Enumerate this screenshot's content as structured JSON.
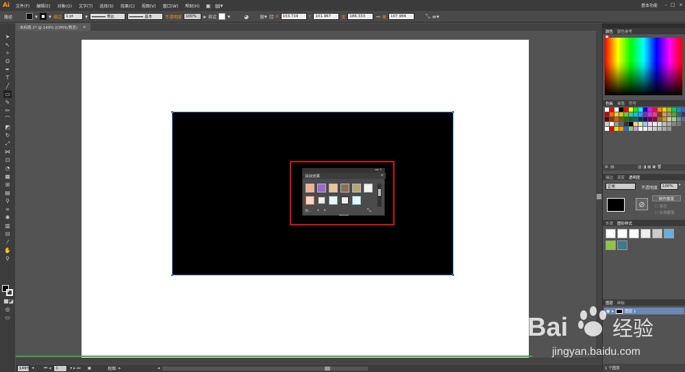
{
  "app": {
    "logo": "Ai",
    "workspace": "基本功能"
  },
  "menu": [
    "文件(F)",
    "编辑(E)",
    "对象(O)",
    "文字(T)",
    "选择(S)",
    "效果(C)",
    "视图(V)",
    "窗口(W)",
    "帮助(H)"
  ],
  "control": {
    "path_label": "路径",
    "stroke_label": "描边",
    "stroke_weight": "1 pt",
    "profile": "等比",
    "brush": "基本",
    "opacity_label": "不透明度",
    "opacity": "100%",
    "style_label": "样式",
    "x": "153.719",
    "y": "101.967",
    "w": "186.333",
    "h": "107.984"
  },
  "document": {
    "tab_title": "未标题-1* @ 149% (CMYK/预览)",
    "close": "×"
  },
  "scribble_panel": {
    "title": "涂抹效果",
    "footer": "涂..."
  },
  "status": {
    "zoom": "149%",
    "page": "1",
    "mode": "抠图"
  },
  "panels": {
    "color": {
      "tabs": [
        "颜色",
        "颜色参考"
      ]
    },
    "swatches": {
      "tabs": [
        "色板",
        "画笔",
        "符号"
      ]
    },
    "transparency": {
      "tabs": [
        "描边",
        "渐变",
        "透明度"
      ],
      "blend_mode": "正常",
      "opacity_label": "不透明度",
      "opacity": "100%",
      "make_mask": "制作蒙版",
      "clip": "剪切",
      "invert": "反相蒙版"
    },
    "appearance": {
      "tabs": [
        "外观",
        "图形样式"
      ]
    },
    "layers": {
      "tabs": [
        "图层",
        "画板"
      ],
      "layer_name": "图层 1",
      "count": "1 个图层"
    }
  },
  "watermark": {
    "brand_left": "Bai",
    "brand_right": "经验",
    "url": "jingyan.baidu.com"
  },
  "colors": {
    "accent": "#ff9a00",
    "highlight": "#e01010",
    "selection": "#4a7fd0"
  }
}
